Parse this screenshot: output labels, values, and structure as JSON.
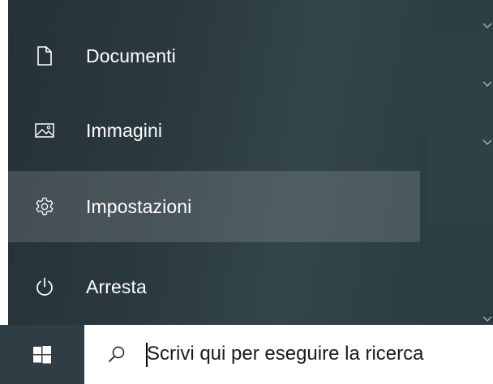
{
  "start_menu": {
    "items": [
      {
        "label": "Documenti",
        "icon": "document-icon",
        "selected": false
      },
      {
        "label": "Immagini",
        "icon": "pictures-icon",
        "selected": false
      },
      {
        "label": "Impostazioni",
        "icon": "gear-icon",
        "selected": true
      },
      {
        "label": "Arresta",
        "icon": "power-icon",
        "selected": false
      }
    ],
    "chevron_icon": "chevron-down-icon"
  },
  "taskbar": {
    "start_icon": "windows-logo-icon",
    "search": {
      "placeholder": "Scrivi qui per eseguire la ricerca",
      "icon": "search-icon"
    }
  },
  "colors": {
    "menu_background": "#2b3a40",
    "selected_highlight": "#485458",
    "taskbar_start": "#2f3e44",
    "search_background": "#ffffff",
    "text_light": "#ffffff",
    "text_dark": "#1a1a1a"
  }
}
